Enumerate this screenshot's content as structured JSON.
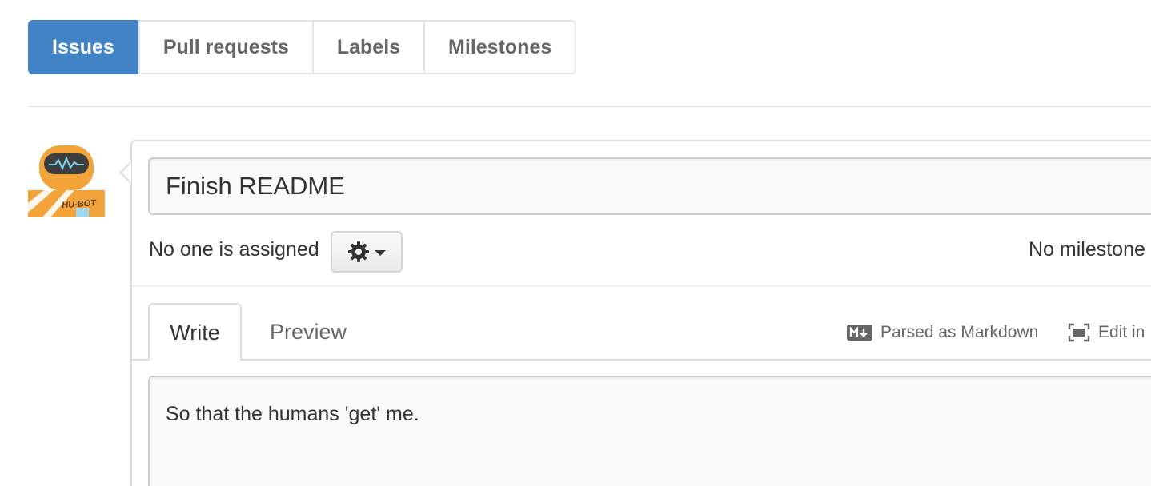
{
  "subnav": {
    "items": [
      {
        "label": "Issues",
        "selected": true
      },
      {
        "label": "Pull requests",
        "selected": false
      },
      {
        "label": "Labels",
        "selected": false
      },
      {
        "label": "Milestones",
        "selected": false
      }
    ]
  },
  "avatar": {
    "badge_text": "HU-BOT"
  },
  "issue_form": {
    "title_value": "Finish README",
    "assignee_text": "No one is assigned",
    "milestone_text": "No milestone",
    "tabs": {
      "write_label": "Write",
      "preview_label": "Preview"
    },
    "markdown_hint": "Parsed as Markdown",
    "fullscreen_hint": "Edit in",
    "body_value": "So that the humans 'get' me."
  },
  "colors": {
    "accent": "#4183c4",
    "robot_orange": "#f2a43a",
    "border": "#dddddd"
  },
  "icons": {
    "gear": "gear-icon",
    "caret": "chevron-down-icon",
    "markdown": "markdown-icon",
    "fullscreen": "fullscreen-icon"
  }
}
